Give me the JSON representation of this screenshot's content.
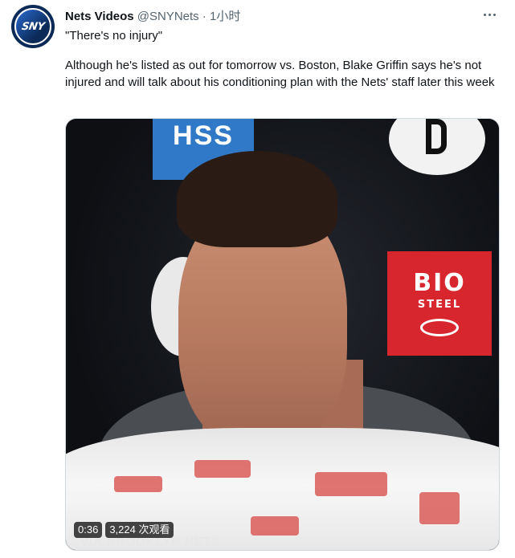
{
  "tweet": {
    "display_name": "Nets Videos",
    "handle": "@SNYNets",
    "separator": "·",
    "time": "1小时",
    "quote": "\"There's no injury\"",
    "body": "Although he's listed as out for tomorrow vs. Boston, Blake Griffin says he's not injured and will talk about his conditioning plan with the Nets' staff later this week",
    "avatar_text": "SNY"
  },
  "media": {
    "banner_text": "HSS",
    "sponsor_top": "BIO",
    "sponsor_bottom": "STEEL",
    "duration": "0:36",
    "views": "3,224 次观看",
    "watermark": "VIA BROOKLYN NETS"
  },
  "colors": {
    "text_primary": "#0f1419",
    "text_secondary": "#536471",
    "avatar_bg": "#0b2a57",
    "sponsor_red": "#d7262e",
    "banner_blue": "#2f79c8"
  },
  "icons": {
    "more": "more-horizontal-icon"
  }
}
